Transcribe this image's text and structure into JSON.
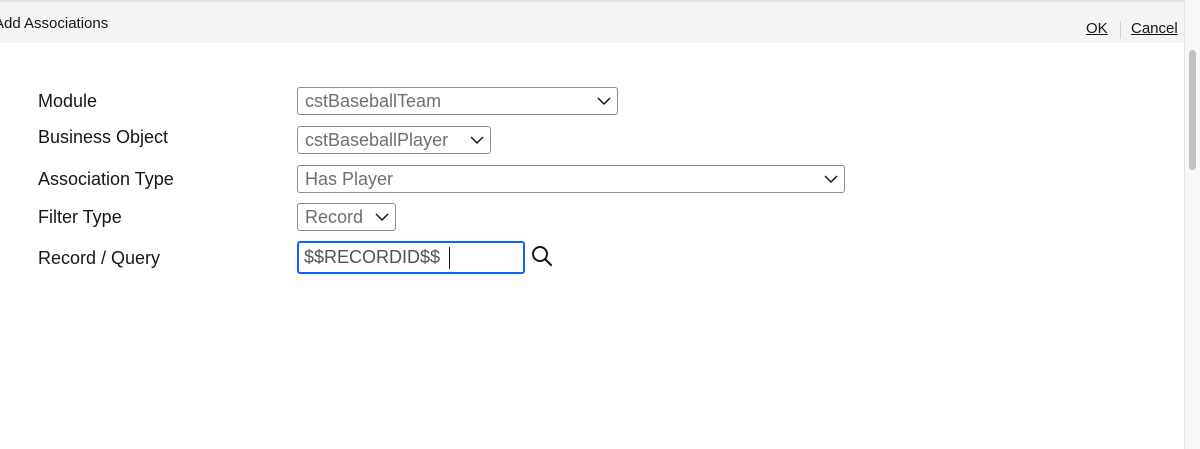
{
  "dialog": {
    "title": "Add Associations",
    "ok_label": "OK",
    "cancel_label": "Cancel"
  },
  "form": {
    "module": {
      "label": "Module",
      "value": "cstBaseballTeam"
    },
    "business_object": {
      "label": "Business Object",
      "value": "cstBaseballPlayer"
    },
    "association_type": {
      "label": "Association Type",
      "value": "Has Player"
    },
    "filter_type": {
      "label": "Filter Type",
      "value": "Record"
    },
    "record_query": {
      "label": "Record / Query",
      "value": "$$RECORDID$$",
      "search_icon": "search-icon"
    }
  },
  "colors": {
    "header_bg": "#f4f4f4",
    "focus_border": "#0f62fe",
    "field_border": "#8d8d8d",
    "placeholder_text": "#6f6f6f"
  }
}
